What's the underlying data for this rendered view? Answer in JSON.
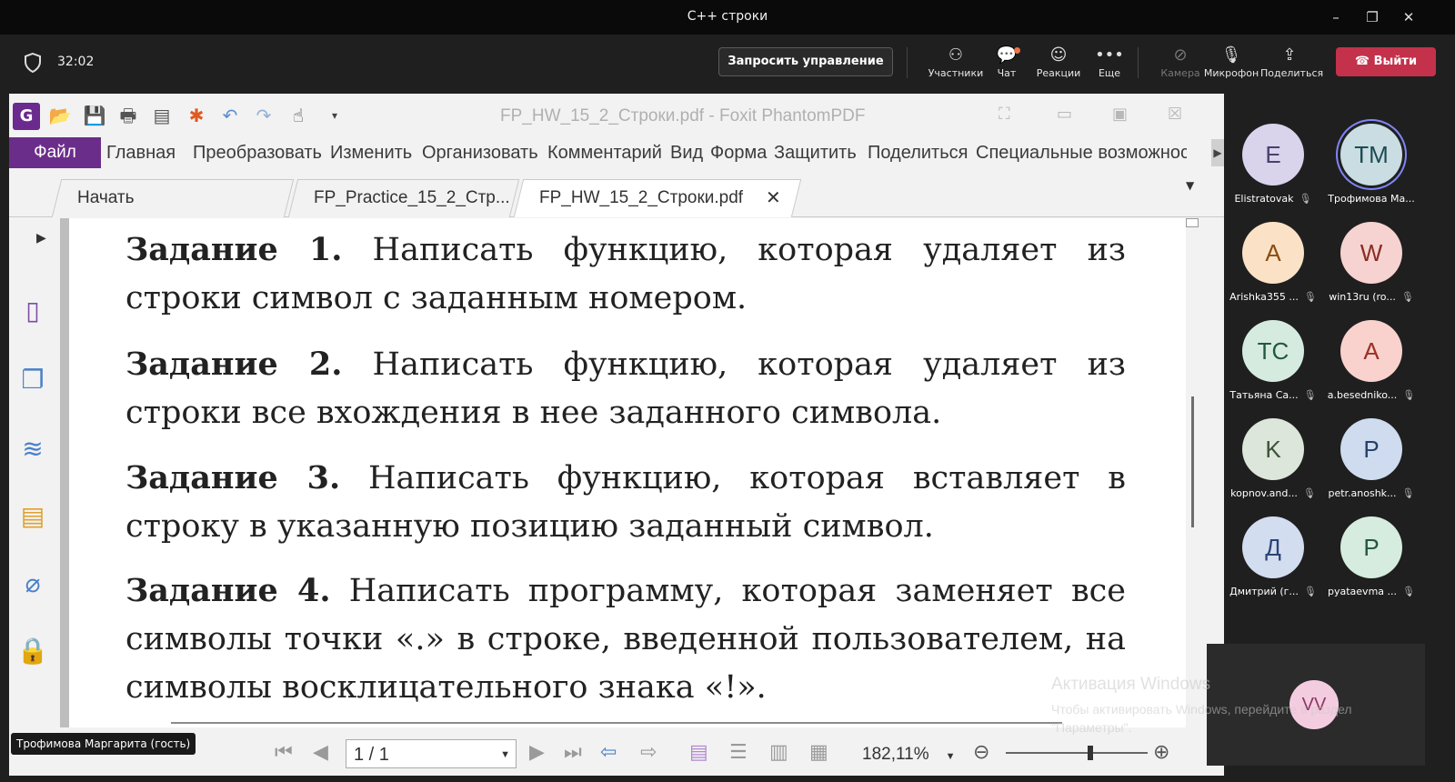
{
  "window": {
    "title": "C++ строки"
  },
  "meeting": {
    "timer": "32:02",
    "request_control": "Запросить управление",
    "toolbar": [
      {
        "label": "Участники",
        "icon": "people-icon"
      },
      {
        "label": "Чат",
        "icon": "chat-icon"
      },
      {
        "label": "Реакции",
        "icon": "reactions-icon"
      },
      {
        "label": "Еще",
        "icon": "more-icon"
      },
      {
        "label": "Камера",
        "icon": "camera-off-icon"
      },
      {
        "label": "Микрофон",
        "icon": "mic-off-icon"
      },
      {
        "label": "Поделиться",
        "icon": "share-icon"
      }
    ],
    "leave": "Выйти",
    "accent": "#7f85f5",
    "leave_color": "#c4314b"
  },
  "foxit": {
    "title": "FP_HW_15_2_Строки.pdf - Foxit PhantomPDF",
    "file_menu": "Файл",
    "menu": [
      "Главная",
      "Преобразовать",
      "Изменить",
      "Организовать",
      "Комментарий",
      "Вид",
      "Форма",
      "Защитить",
      "Поделиться",
      "Специальные возможнос"
    ],
    "tabs": [
      "Начать",
      "FP_Practice_15_2_Стр...",
      "FP_HW_15_2_Строки.pdf"
    ],
    "page_indicator": "1 / 1",
    "zoom": "182,11%",
    "brand_color": "#6b2d8a"
  },
  "document": {
    "tasks": [
      {
        "label": "Задание 1.",
        "text": " Написать функцию, которая удаляет из строки символ с заданным номером."
      },
      {
        "label": "Задание 2.",
        "text": " Написать функцию, которая удаляет из строки все вхождения в нее заданного символа."
      },
      {
        "label": "Задание 3.",
        "text": " Написать функцию, которая вставляет в строку в указанную позицию заданный символ."
      },
      {
        "label": "Задание 4.",
        "text": " Написать программу, которая заменяет все символы точки «.» в строке, введенной пользователем, на символы восклицательного знака «!»."
      }
    ]
  },
  "presenter_label": "Трофимова Маргарита (гость)",
  "participants": [
    {
      "initials": "E",
      "name": "Elistratovak",
      "bg": "#d9d3ec",
      "fg": "#4b3f6e"
    },
    {
      "initials": "ТМ",
      "name": "Трофимова Ма...",
      "bg": "#c9dde2",
      "fg": "#1f4a55"
    },
    {
      "initials": "A",
      "name": "Arishka355 ...",
      "bg": "#fbe2c6",
      "fg": "#8a4d12"
    },
    {
      "initials": "W",
      "name": "win13ru (ro...",
      "bg": "#f6d3d0",
      "fg": "#8a2c24"
    },
    {
      "initials": "ТС",
      "name": "Татьяна Са...",
      "bg": "#d5ebdf",
      "fg": "#24573c"
    },
    {
      "initials": "A",
      "name": "a.besedniko...",
      "bg": "#f9d2cd",
      "fg": "#9a3124"
    },
    {
      "initials": "K",
      "name": "kopnov.and...",
      "bg": "#dce6da",
      "fg": "#3b5236"
    },
    {
      "initials": "P",
      "name": "petr.anoshk...",
      "bg": "#cfdcef",
      "fg": "#27406b"
    },
    {
      "initials": "Д",
      "name": "Дмитрий (г...",
      "bg": "#d3ddf0",
      "fg": "#2c4476"
    },
    {
      "initials": "P",
      "name": "pyataevma ...",
      "bg": "#d6ecdf",
      "fg": "#25573a"
    }
  ],
  "self": {
    "initials": "VV"
  },
  "watermark": {
    "line1": "Активация Windows",
    "line2": "Чтобы активировать Windows, перейдите в раздел",
    "line3": "\"Параметры\"."
  }
}
